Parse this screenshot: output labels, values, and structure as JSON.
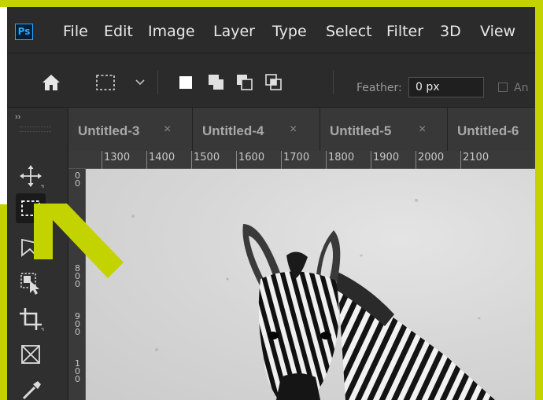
{
  "app": {
    "logo": "Ps",
    "menu": [
      "File",
      "Edit",
      "Image",
      "Layer",
      "Type",
      "Select",
      "Filter",
      "3D",
      "View"
    ]
  },
  "options_bar": {
    "home_icon": "home-icon",
    "tool_icon": "rectangular-marquee-icon",
    "feather_label": "Feather:",
    "feather_value": "0 px",
    "anti_alias_label": "An"
  },
  "tabs": [
    {
      "label": "Untitled-3"
    },
    {
      "label": "Untitled-4"
    },
    {
      "label": "Untitled-5"
    },
    {
      "label": "Untitled-6"
    }
  ],
  "tab_close_glyph": "×",
  "toolbar": {
    "collapse_glyph": "››",
    "tools": [
      "move-icon",
      "rectangular-marquee-icon",
      "lasso-icon",
      "object-selection-icon",
      "crop-icon",
      "frame-icon",
      "eyedropper-icon"
    ]
  },
  "ruler": {
    "horizontal": [
      "1300",
      "1400",
      "1500",
      "1600",
      "1700",
      "1800",
      "1900",
      "2000",
      "2100"
    ],
    "vertical": [
      "0 0",
      "0",
      "8 0 0",
      "9 0 0",
      "1 0 0"
    ]
  },
  "colors": {
    "frame_border": "#c3d300",
    "arrow": "#c3d300",
    "app_bg": "#2b2b2b",
    "ps_blue": "#31a8ff"
  }
}
